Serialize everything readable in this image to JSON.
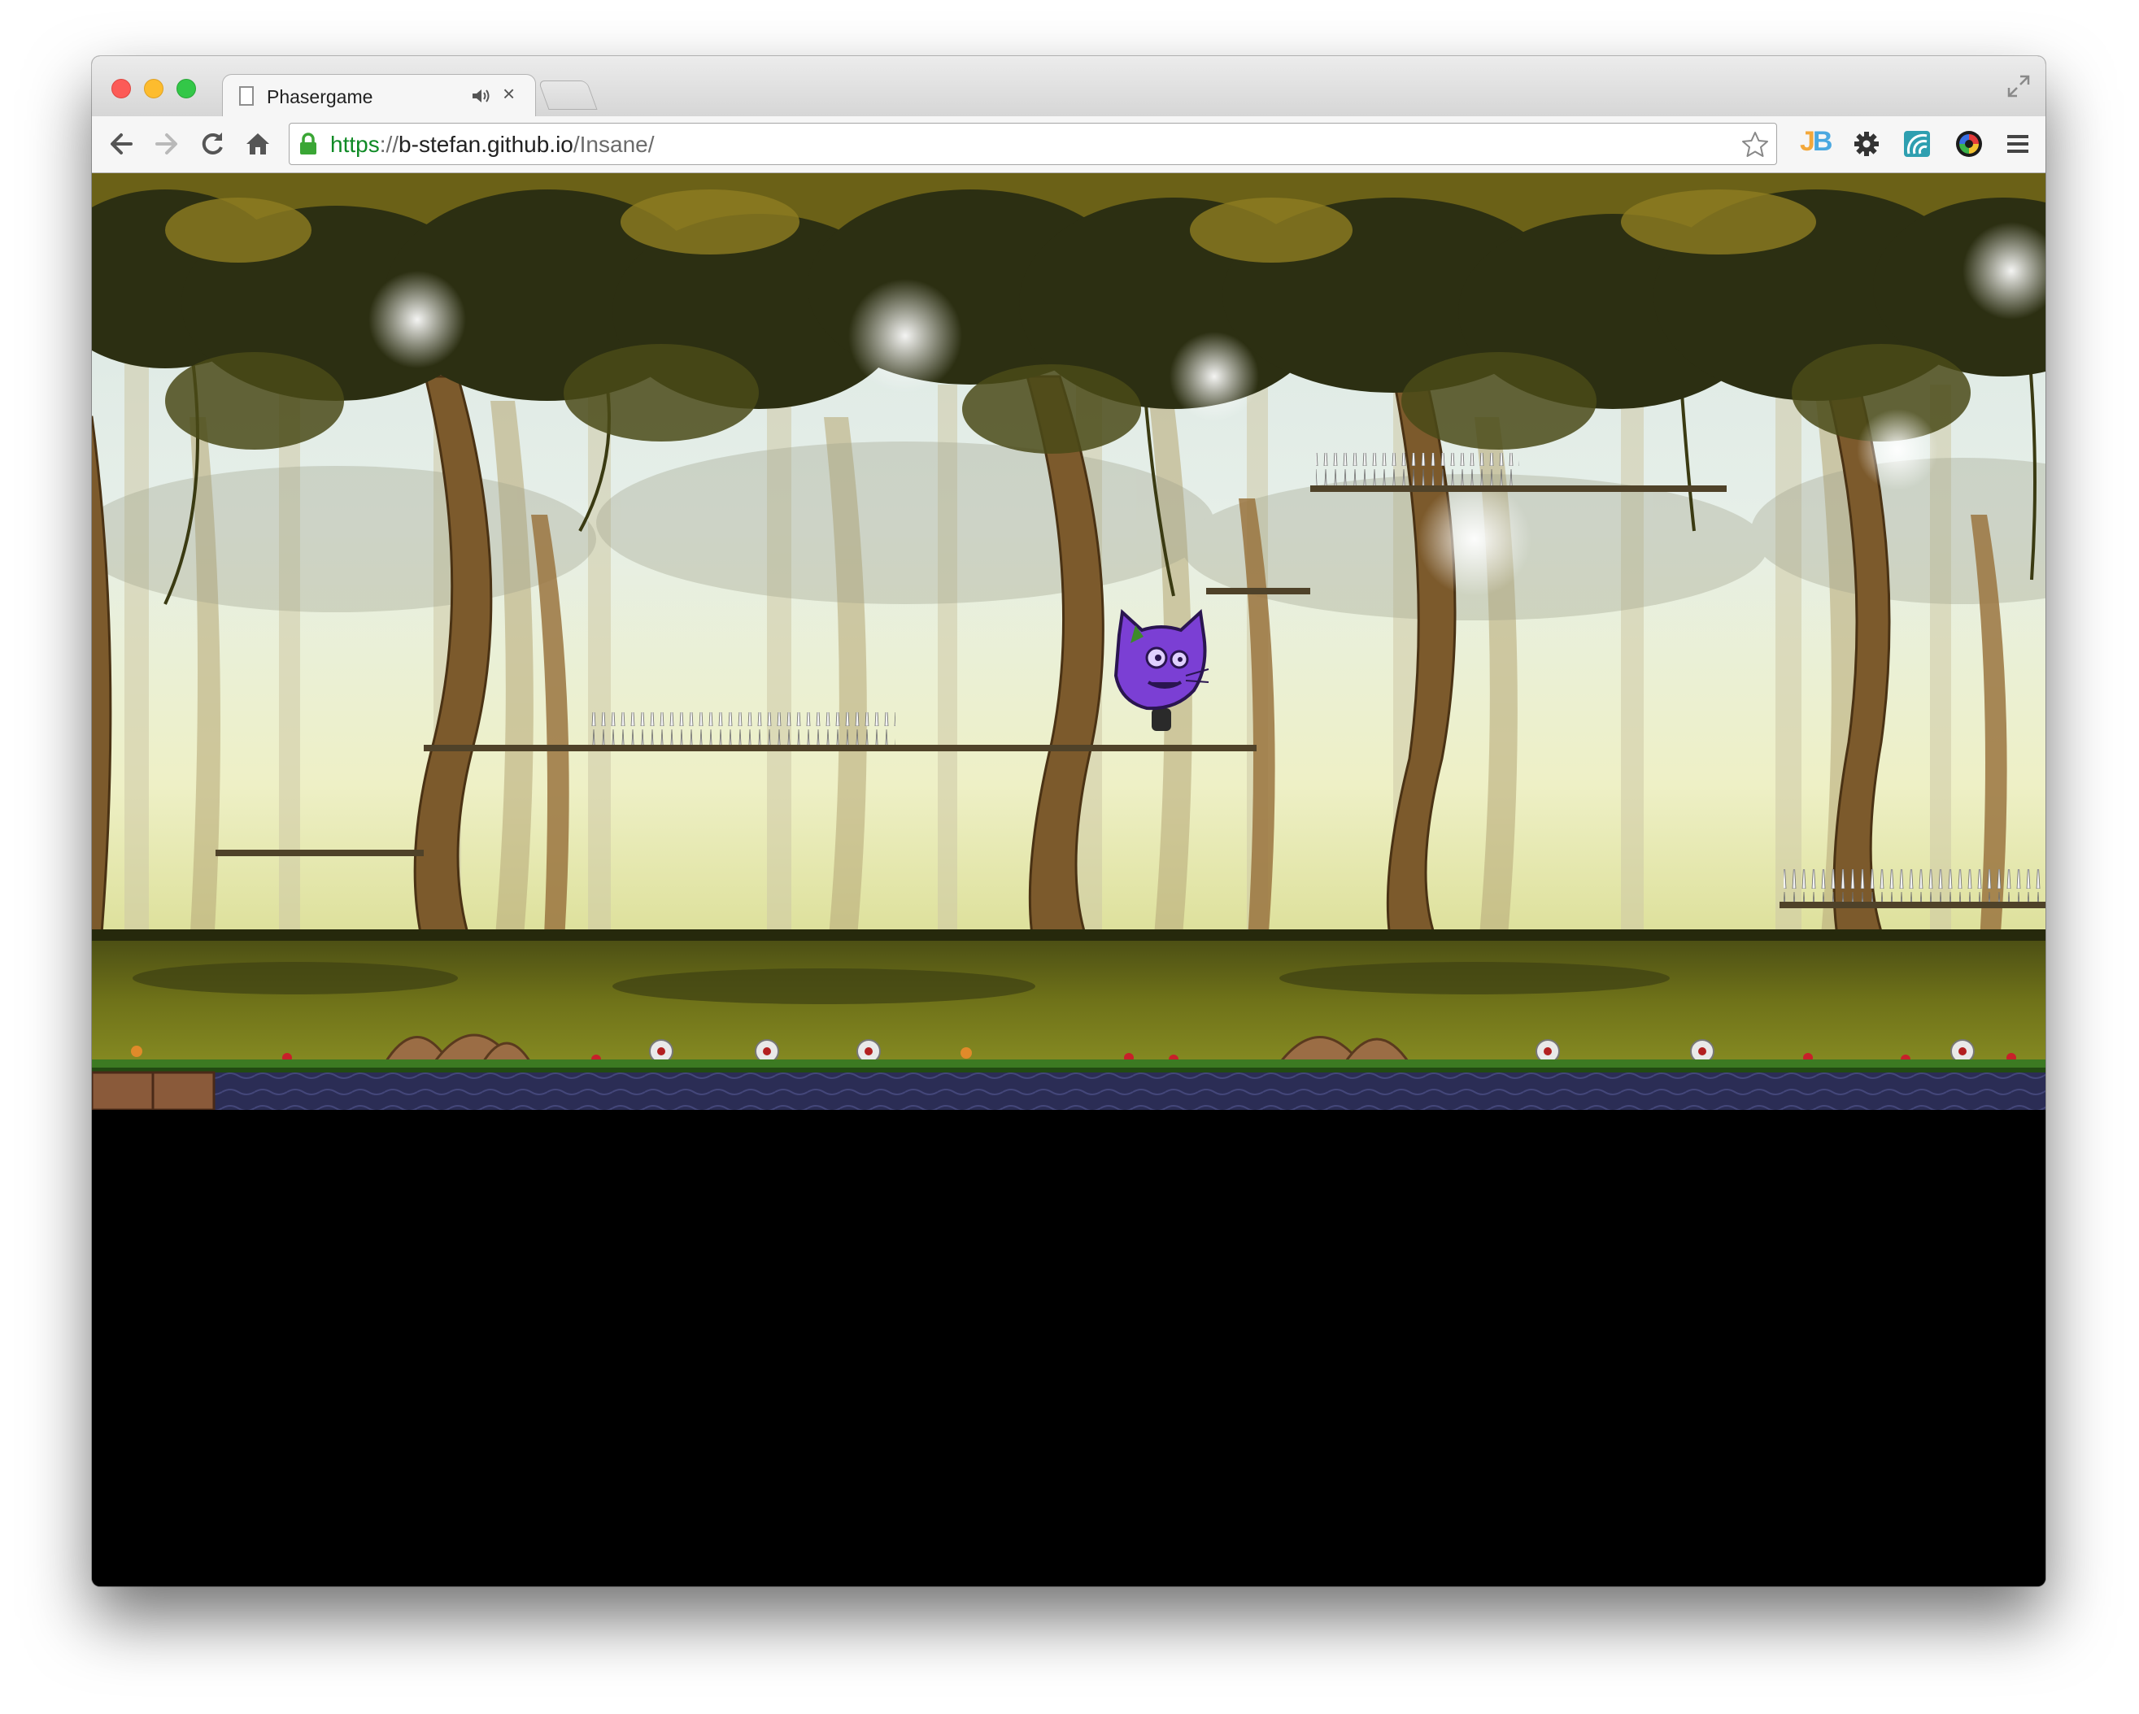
{
  "browser": {
    "tab": {
      "title": "Phasergame"
    },
    "address_bar": {
      "scheme": "https",
      "separator": "://",
      "host": "b-stefan.github.io",
      "path": "/Insane/"
    },
    "extensions": [
      "jb-icon",
      "gear-icon",
      "extension-wave-icon",
      "extension-color-wheel-icon"
    ],
    "colors": {
      "secure_scheme": "#0f8a25",
      "tab_bar": "#e2e2e2"
    }
  },
  "game": {
    "scene": "jungle-forest-level",
    "player": "purple-cat-character",
    "colors": {
      "sky": "#e8f0cf",
      "canopy": "#2c2f12",
      "ground": "#6b6f18",
      "water": "#2a2c52",
      "player": "#7b3fd4"
    }
  }
}
